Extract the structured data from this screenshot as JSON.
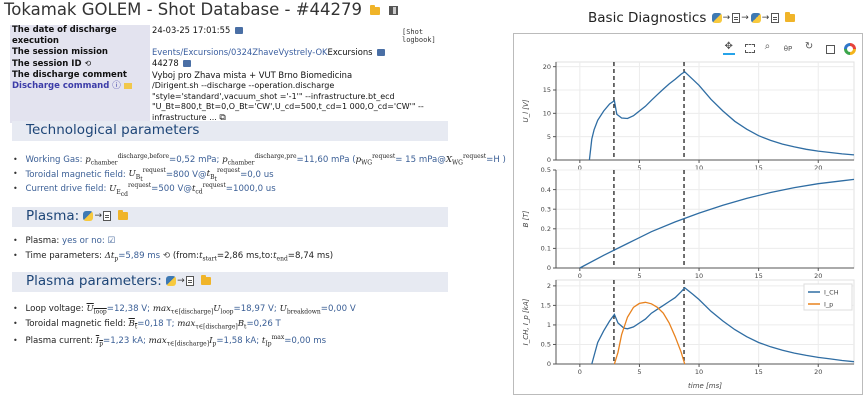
{
  "header": {
    "title": "Tokamak GOLEM - Shot Database - #44279",
    "folder_icon": "folder-icon",
    "qr_icon": "qr-code-icon"
  },
  "info": {
    "rows": [
      {
        "label": "The date of discharge execution",
        "value": "24-03-25 17:01:55"
      },
      {
        "label": "The session mission",
        "value": "Events/Excursions/0324ZhaveVystrely-OK",
        "value_suffix": "Excursions"
      },
      {
        "label": "The session ID",
        "value": "44278"
      },
      {
        "label": "The discharge comment",
        "value": "Vyboj pro Zhava mista + VUT Brno Biomedicina"
      },
      {
        "label": "Discharge command",
        "value": "/Dirigent.sh --discharge --operation.discharge \"style='standard',vacuum_shot ='-1'\" --infrastructure.bt_ecd \"U_Bt=800,t_Bt=0,O_Bt='CW',U_cd=500,t_cd=1 000,O_cd='CW'\" --infrastructure ..."
      }
    ],
    "shot_logbook": "[Shot logbook]"
  },
  "sections": {
    "tech": {
      "title": "Technological parameters",
      "working_gas": {
        "label": "Working Gas:",
        "p_before": "=0,52 mPa;",
        "p_pre": "=11,60 mPa (",
        "p_wg": "= 15 mPa@",
        "x_wg": "=H )"
      },
      "toroidal": {
        "label": "Toroidal magnetic field:",
        "u_req": "=800 V@",
        "t_req": "=0,0 us"
      },
      "current_drive": {
        "label": "Current drive field:",
        "u_req": "=500 V@",
        "t_req": "=1000,0 us"
      }
    },
    "plasma": {
      "title": "Plasma:",
      "yes_no_label": "Plasma: ",
      "yes_no_value": "yes or no: ☑",
      "time_label": "Time parameters:",
      "dt": "=5,89 ms",
      "from_text": "(from:",
      "t_start": "=2,86 ms,to:",
      "t_end": "=8,74 ms)"
    },
    "plasma_params": {
      "title": "Plasma parameters:",
      "loop_label": "Loop voltage:",
      "loop_mean": "=12,38 V;",
      "loop_max": "=18,97 V;",
      "loop_breakdown": "=0,00 V",
      "tor_label": "Toroidal magnetic field:",
      "tor_mean": "=0,18 T;",
      "tor_max": "=0,26 T",
      "cur_label": "Plasma current:",
      "cur_mean": "=1,23 kA;",
      "cur_max": "=1,58 kA;",
      "cur_tmax": "=0,00 ms"
    }
  },
  "right": {
    "title": "Basic Diagnostics",
    "toolbar": [
      "pan-icon",
      "box-zoom-icon",
      "wheel-zoom-icon",
      "hover-icon",
      "reset-icon",
      "save-icon",
      "bokeh-logo-icon"
    ],
    "toolbar_text": "θP"
  },
  "chart_data": [
    {
      "type": "line",
      "ylabel": "U_l [V]",
      "xlim": [
        -2,
        23
      ],
      "ylim": [
        0,
        21
      ],
      "yticks": [
        0,
        5,
        10,
        15,
        20
      ],
      "xticks": [
        0,
        5,
        10,
        15,
        20
      ],
      "vlines": [
        2.86,
        8.74
      ],
      "series": [
        {
          "color": "#2f6da3",
          "x": [
            0.8,
            1.0,
            1.2,
            1.5,
            2.0,
            2.5,
            2.9,
            3.1,
            3.5,
            4.0,
            4.5,
            5.0,
            5.5,
            6.0,
            6.5,
            7.0,
            7.5,
            8.0,
            8.5,
            8.8,
            9.5,
            10.0,
            11.0,
            12.0,
            13.0,
            14.0,
            15.0,
            16.0,
            17.0,
            18.0,
            19.0,
            20.0,
            21.0,
            22.0,
            23.0
          ],
          "y": [
            0,
            4.5,
            6.5,
            8.5,
            10.5,
            12.0,
            12.7,
            9.8,
            9.0,
            8.9,
            9.5,
            10.5,
            11.5,
            12.8,
            14.0,
            15.2,
            16.3,
            17.3,
            18.4,
            18.9,
            17.2,
            16.0,
            13.0,
            10.5,
            8.3,
            6.6,
            5.2,
            4.2,
            3.4,
            2.8,
            2.3,
            1.9,
            1.6,
            1.3,
            1.1
          ]
        }
      ]
    },
    {
      "type": "line",
      "ylabel": "B [T]",
      "xlim": [
        -2,
        23
      ],
      "ylim": [
        0,
        0.5
      ],
      "yticks": [
        0,
        0.1,
        0.2,
        0.3,
        0.4,
        0.5
      ],
      "xticks": [
        0,
        5,
        10,
        15,
        20
      ],
      "vlines": [
        2.86,
        8.74
      ],
      "series": [
        {
          "color": "#2f6da3",
          "x": [
            0,
            2,
            4,
            6,
            8,
            10,
            12,
            14,
            16,
            18,
            20,
            22,
            23
          ],
          "y": [
            0.0,
            0.065,
            0.125,
            0.185,
            0.235,
            0.28,
            0.32,
            0.355,
            0.385,
            0.41,
            0.43,
            0.445,
            0.452
          ]
        }
      ]
    },
    {
      "type": "line",
      "ylabel": "I_CH, I_p [kA]",
      "xlabel": "time [ms]",
      "xlim": [
        -2,
        23
      ],
      "ylim": [
        0,
        2.15
      ],
      "yticks": [
        0,
        0.5,
        1,
        1.5,
        2
      ],
      "xticks": [
        0,
        5,
        10,
        15,
        20
      ],
      "vlines": [
        2.86,
        8.74
      ],
      "legend": "right",
      "series": [
        {
          "name": "I_CH",
          "color": "#2f6da3",
          "x": [
            1.0,
            1.5,
            2.0,
            2.5,
            2.9,
            3.2,
            3.7,
            4.0,
            4.5,
            5.0,
            5.5,
            6.0,
            6.5,
            7.0,
            7.5,
            8.0,
            8.5,
            8.8,
            9.5,
            10.0,
            11.0,
            12.0,
            13.0,
            14.0,
            15.0,
            16.0,
            17.0,
            18.0,
            19.0,
            20.0,
            21.0,
            22.0,
            23.0
          ],
          "y": [
            0,
            0.55,
            0.85,
            1.1,
            1.27,
            1.05,
            0.92,
            0.9,
            0.95,
            1.05,
            1.15,
            1.3,
            1.4,
            1.5,
            1.6,
            1.7,
            1.85,
            1.95,
            1.78,
            1.65,
            1.35,
            1.1,
            0.88,
            0.7,
            0.55,
            0.44,
            0.35,
            0.28,
            0.22,
            0.17,
            0.13,
            0.09,
            0.06
          ]
        },
        {
          "name": "I_p",
          "color": "#e8821e",
          "x": [
            2.9,
            3.2,
            3.5,
            4.0,
            4.5,
            5.0,
            5.5,
            6.0,
            6.5,
            7.0,
            7.5,
            8.0,
            8.5,
            8.8
          ],
          "y": [
            0.0,
            0.3,
            0.75,
            1.2,
            1.45,
            1.55,
            1.58,
            1.54,
            1.45,
            1.3,
            1.05,
            0.7,
            0.3,
            0.0
          ]
        }
      ]
    }
  ]
}
